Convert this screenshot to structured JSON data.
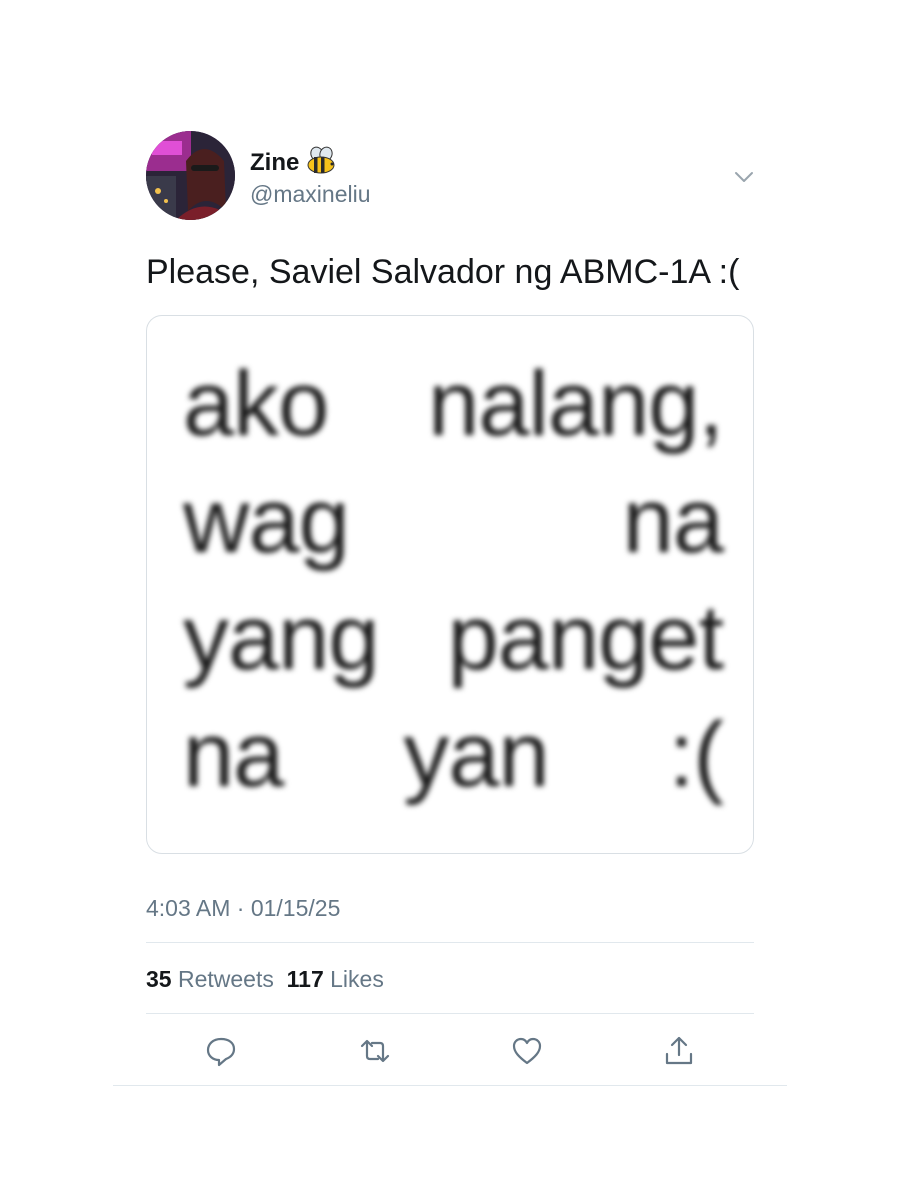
{
  "tweet": {
    "author": {
      "display_name": "Zine",
      "name_emoji": "bee-emoji",
      "handle": "@maxineliu",
      "avatar": "profile-photo"
    },
    "menu_icon": "chevron-down-icon",
    "text": "Please, Saviel Salvador ng ABMC-1A :(",
    "media": {
      "lines": [
        [
          "ako",
          "nalang,"
        ],
        [
          "wag",
          "na"
        ],
        [
          "yang",
          "panget"
        ],
        [
          "na",
          "yan",
          ":("
        ]
      ]
    },
    "timestamp": "4:03 AM · 01/15/25",
    "stats": {
      "retweets_count": "35",
      "retweets_label": "Retweets",
      "likes_count": "117",
      "likes_label": "Likes"
    },
    "actions": [
      "reply-icon",
      "retweet-icon",
      "like-icon",
      "share-icon"
    ]
  },
  "colors": {
    "text_primary": "#14171a",
    "text_secondary": "#657786",
    "divider": "#e1e8ed",
    "icon": "#657786"
  }
}
